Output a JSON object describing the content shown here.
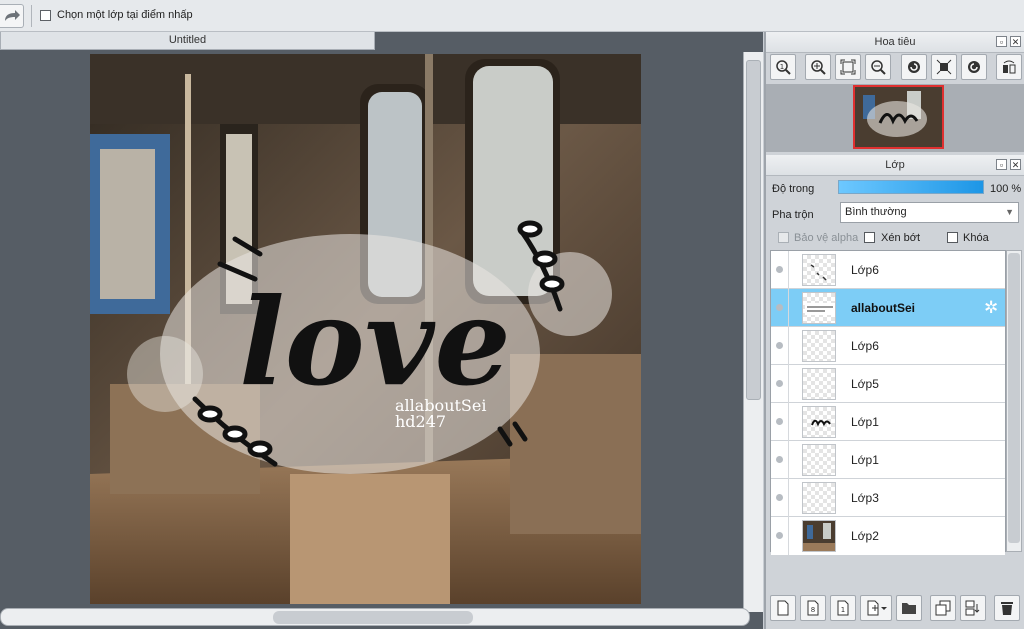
{
  "toolbar": {
    "redo_icon": "redo-arrow-icon",
    "select_layer_checkbox_label": "Chọn một lớp tại điểm nhấp",
    "select_layer_checked": false
  },
  "document": {
    "tab_title": "Untitled"
  },
  "canvas": {
    "artwork_text": "love",
    "watermark_line1": "allaboutSei",
    "watermark_line2": "hd247"
  },
  "navigator": {
    "title": "Hoa tiêu",
    "tools": [
      "zoom-actual-icon",
      "zoom-in-icon",
      "fit-screen-icon",
      "zoom-out-icon",
      "rotate-left-icon",
      "fit-window-icon",
      "rotate-right-icon",
      "flip-icon"
    ]
  },
  "layers_panel": {
    "title": "Lớp",
    "opacity_label": "Độ trong",
    "opacity_value": "100 %",
    "opacity_fraction": 1.0,
    "blend_label": "Pha trộn",
    "blend_value": "Bình thường",
    "protect_alpha_label": "Bảo vệ alpha",
    "clipping_label": "Xén bớt",
    "lock_label": "Khóa",
    "layers": [
      {
        "name": "Lớp6",
        "selected": false
      },
      {
        "name": "allaboutSei",
        "selected": true
      },
      {
        "name": "Lớp6",
        "selected": false
      },
      {
        "name": "Lớp5",
        "selected": false
      },
      {
        "name": "Lớp1",
        "selected": false
      },
      {
        "name": "Lớp1",
        "selected": false
      },
      {
        "name": "Lớp3",
        "selected": false
      },
      {
        "name": "Lớp2",
        "selected": false
      }
    ],
    "bottom_tools": [
      "new-layer-icon",
      "new-halftone-layer-icon",
      "new-1bit-layer-icon",
      "add-layer-menu-icon",
      "new-folder-icon",
      "duplicate-layer-icon",
      "merge-down-icon",
      "delete-layer-icon"
    ]
  },
  "colors": {
    "selected_row": "#7dcdf6",
    "opacity_bar": "#1d96e6",
    "canvas_bg": "#565d65"
  }
}
